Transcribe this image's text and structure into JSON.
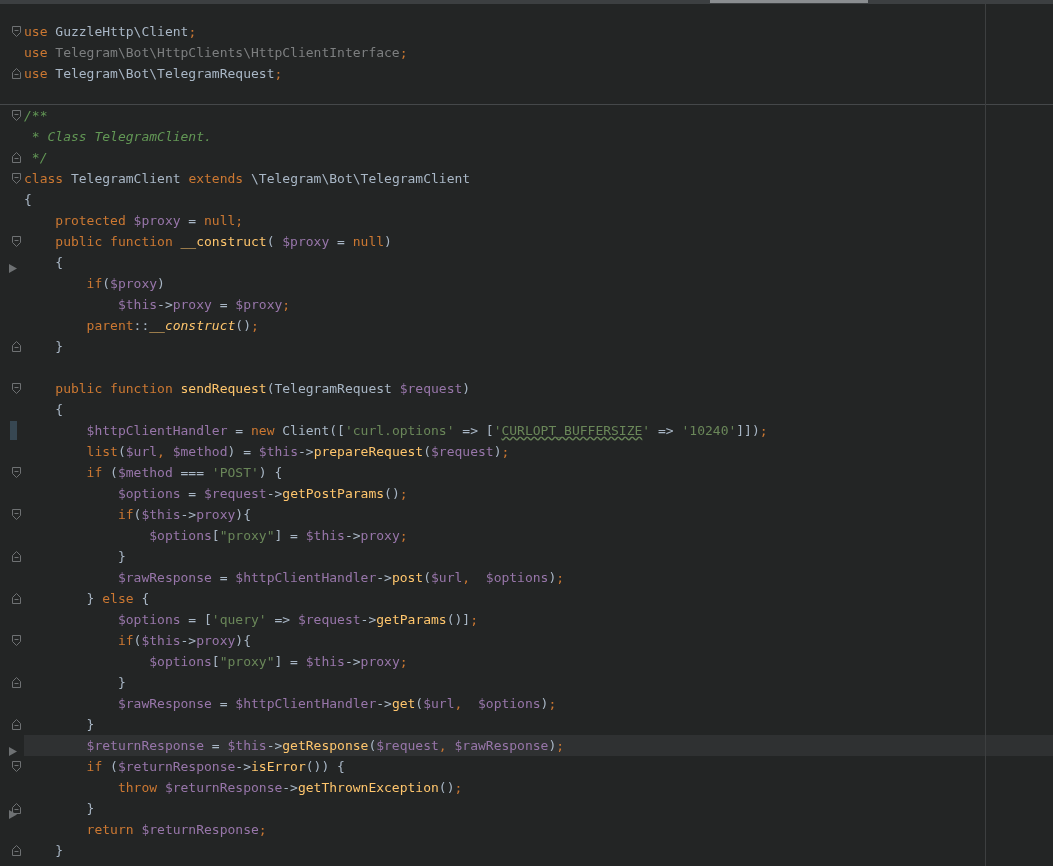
{
  "editor": {
    "lines": [
      {
        "fold_start": true,
        "fold_end": false,
        "selected": false,
        "tokens": [
          {
            "kind": "kw",
            "text": "use "
          },
          {
            "kind": "plain",
            "text": "GuzzleHttp\\Client"
          },
          {
            "kind": "kw",
            "text": ";"
          }
        ]
      },
      {
        "fold_start": false,
        "fold_end": false,
        "selected": false,
        "tokens": [
          {
            "kind": "kw",
            "text": "use "
          },
          {
            "kind": "dim",
            "text": "Telegram\\Bot\\HttpClients\\HttpClientInterface"
          },
          {
            "kind": "kw",
            "text": ";"
          }
        ]
      },
      {
        "fold_start": false,
        "fold_end": true,
        "selected": false,
        "tokens": [
          {
            "kind": "kw",
            "text": "use "
          },
          {
            "kind": "plain",
            "text": "Telegram\\Bot\\TelegramRequest"
          },
          {
            "kind": "kw",
            "text": ";"
          }
        ]
      },
      {
        "fold_start": true,
        "fold_end": false,
        "selected": false,
        "section_break": true,
        "tokens": [
          {
            "kind": "doc",
            "text": "/**"
          }
        ]
      },
      {
        "fold_start": false,
        "fold_end": false,
        "selected": false,
        "tokens": [
          {
            "kind": "doc",
            "text": " * Class TelegramClient."
          }
        ]
      },
      {
        "fold_start": false,
        "fold_end": true,
        "selected": false,
        "tokens": [
          {
            "kind": "doc",
            "text": " */"
          }
        ]
      },
      {
        "fold_start": true,
        "fold_end": false,
        "selected": false,
        "tokens": [
          {
            "kind": "kw",
            "text": "class "
          },
          {
            "kind": "plain",
            "text": "TelegramClient "
          },
          {
            "kind": "kw",
            "text": "extends "
          },
          {
            "kind": "plain",
            "text": "\\Telegram\\Bot\\TelegramClient"
          }
        ]
      },
      {
        "fold_start": false,
        "fold_end": false,
        "selected": false,
        "tokens": [
          {
            "kind": "plain",
            "text": "{"
          }
        ]
      },
      {
        "fold_start": false,
        "fold_end": false,
        "selected": false,
        "tokens": [
          {
            "kind": "kw",
            "text": "    protected "
          },
          {
            "kind": "var",
            "text": "$proxy"
          },
          {
            "kind": "plain",
            "text": " = "
          },
          {
            "kind": "kw",
            "text": "null;"
          }
        ]
      },
      {
        "fold_start": true,
        "fold_end": false,
        "selected": false,
        "tokens": [
          {
            "kind": "kw",
            "text": "    public function "
          },
          {
            "kind": "fn",
            "text": "__construct"
          },
          {
            "kind": "plain",
            "text": "( "
          },
          {
            "kind": "var",
            "text": "$proxy"
          },
          {
            "kind": "plain",
            "text": " = "
          },
          {
            "kind": "kw",
            "text": "null"
          },
          {
            "kind": "plain",
            "text": ")"
          }
        ]
      },
      {
        "fold_start": false,
        "fold_end": false,
        "selected": false,
        "arrow": true,
        "tokens": [
          {
            "kind": "plain",
            "text": "    {"
          }
        ]
      },
      {
        "fold_start": false,
        "fold_end": false,
        "selected": false,
        "tokens": [
          {
            "kind": "kw",
            "text": "        if"
          },
          {
            "kind": "plain",
            "text": "("
          },
          {
            "kind": "var",
            "text": "$proxy"
          },
          {
            "kind": "plain",
            "text": ")"
          }
        ]
      },
      {
        "fold_start": false,
        "fold_end": false,
        "selected": false,
        "tokens": [
          {
            "kind": "var",
            "text": "            $this"
          },
          {
            "kind": "plain",
            "text": "->"
          },
          {
            "kind": "var",
            "text": "proxy"
          },
          {
            "kind": "plain",
            "text": " = "
          },
          {
            "kind": "var",
            "text": "$proxy"
          },
          {
            "kind": "kw",
            "text": ";"
          }
        ]
      },
      {
        "fold_start": false,
        "fold_end": false,
        "selected": false,
        "tokens": [
          {
            "kind": "kw",
            "text": "        parent"
          },
          {
            "kind": "plain",
            "text": "::"
          },
          {
            "kind": "fnit",
            "text": "__construct"
          },
          {
            "kind": "plain",
            "text": "()"
          },
          {
            "kind": "kw",
            "text": ";"
          }
        ]
      },
      {
        "fold_start": false,
        "fold_end": true,
        "selected": false,
        "tokens": [
          {
            "kind": "plain",
            "text": "    }"
          }
        ]
      },
      {
        "fold_start": true,
        "fold_end": false,
        "selected": false,
        "space_before": true,
        "tokens": [
          {
            "kind": "kw",
            "text": "    public function "
          },
          {
            "kind": "fn",
            "text": "sendRequest"
          },
          {
            "kind": "plain",
            "text": "(TelegramRequest "
          },
          {
            "kind": "var",
            "text": "$request"
          },
          {
            "kind": "plain",
            "text": ")"
          }
        ]
      },
      {
        "fold_start": false,
        "fold_end": false,
        "selected": false,
        "tokens": [
          {
            "kind": "plain",
            "text": "    {"
          }
        ]
      },
      {
        "fold_start": false,
        "fold_end": false,
        "selected": false,
        "changed": true,
        "tokens": [
          {
            "kind": "var",
            "text": "        $httpClientHandler"
          },
          {
            "kind": "plain",
            "text": " = "
          },
          {
            "kind": "kw",
            "text": "new "
          },
          {
            "kind": "plain",
            "text": "Client(["
          },
          {
            "kind": "str",
            "text": "'curl.options'"
          },
          {
            "kind": "plain",
            "text": " => ["
          },
          {
            "kind": "str",
            "text": "'"
          },
          {
            "kind": "strw",
            "text": "CURLOPT_BUFFERSIZE"
          },
          {
            "kind": "str",
            "text": "'"
          },
          {
            "kind": "plain",
            "text": " => "
          },
          {
            "kind": "str",
            "text": "'10240'"
          },
          {
            "kind": "plain",
            "text": "]])"
          },
          {
            "kind": "kw",
            "text": ";"
          }
        ]
      },
      {
        "fold_start": false,
        "fold_end": false,
        "selected": false,
        "tokens": [
          {
            "kind": "kw",
            "text": "        list"
          },
          {
            "kind": "plain",
            "text": "("
          },
          {
            "kind": "var",
            "text": "$url"
          },
          {
            "kind": "kw",
            "text": ", "
          },
          {
            "kind": "var",
            "text": "$method"
          },
          {
            "kind": "plain",
            "text": ") = "
          },
          {
            "kind": "var",
            "text": "$this"
          },
          {
            "kind": "plain",
            "text": "->"
          },
          {
            "kind": "fn",
            "text": "prepareRequest"
          },
          {
            "kind": "plain",
            "text": "("
          },
          {
            "kind": "var",
            "text": "$request"
          },
          {
            "kind": "plain",
            "text": ")"
          },
          {
            "kind": "kw",
            "text": ";"
          }
        ]
      },
      {
        "fold_start": true,
        "fold_end": false,
        "selected": false,
        "tokens": [
          {
            "kind": "kw",
            "text": "        if "
          },
          {
            "kind": "plain",
            "text": "("
          },
          {
            "kind": "var",
            "text": "$method"
          },
          {
            "kind": "plain",
            "text": " === "
          },
          {
            "kind": "str",
            "text": "'POST'"
          },
          {
            "kind": "plain",
            "text": ") {"
          }
        ]
      },
      {
        "fold_start": false,
        "fold_end": false,
        "selected": false,
        "tokens": [
          {
            "kind": "var",
            "text": "            $options"
          },
          {
            "kind": "plain",
            "text": " = "
          },
          {
            "kind": "var",
            "text": "$request"
          },
          {
            "kind": "plain",
            "text": "->"
          },
          {
            "kind": "fn",
            "text": "getPostParams"
          },
          {
            "kind": "plain",
            "text": "()"
          },
          {
            "kind": "kw",
            "text": ";"
          }
        ]
      },
      {
        "fold_start": true,
        "fold_end": false,
        "selected": false,
        "tokens": [
          {
            "kind": "kw",
            "text": "            if"
          },
          {
            "kind": "plain",
            "text": "("
          },
          {
            "kind": "var",
            "text": "$this"
          },
          {
            "kind": "plain",
            "text": "->"
          },
          {
            "kind": "var",
            "text": "proxy"
          },
          {
            "kind": "plain",
            "text": "){"
          }
        ]
      },
      {
        "fold_start": false,
        "fold_end": false,
        "selected": false,
        "tokens": [
          {
            "kind": "var",
            "text": "                $options"
          },
          {
            "kind": "plain",
            "text": "["
          },
          {
            "kind": "str",
            "text": "\"proxy\""
          },
          {
            "kind": "plain",
            "text": "] = "
          },
          {
            "kind": "var",
            "text": "$this"
          },
          {
            "kind": "plain",
            "text": "->"
          },
          {
            "kind": "var",
            "text": "proxy"
          },
          {
            "kind": "kw",
            "text": ";"
          }
        ]
      },
      {
        "fold_start": false,
        "fold_end": true,
        "selected": false,
        "tokens": [
          {
            "kind": "plain",
            "text": "            }"
          }
        ]
      },
      {
        "fold_start": false,
        "fold_end": false,
        "selected": false,
        "tokens": [
          {
            "kind": "var",
            "text": "            $rawResponse"
          },
          {
            "kind": "plain",
            "text": " = "
          },
          {
            "kind": "var",
            "text": "$httpClientHandler"
          },
          {
            "kind": "plain",
            "text": "->"
          },
          {
            "kind": "fn",
            "text": "post"
          },
          {
            "kind": "plain",
            "text": "("
          },
          {
            "kind": "var",
            "text": "$url"
          },
          {
            "kind": "kw",
            "text": ",  "
          },
          {
            "kind": "var",
            "text": "$options"
          },
          {
            "kind": "plain",
            "text": ")"
          },
          {
            "kind": "kw",
            "text": ";"
          }
        ]
      },
      {
        "fold_start": false,
        "fold_end": true,
        "selected": false,
        "tokens": [
          {
            "kind": "plain",
            "text": "        } "
          },
          {
            "kind": "kw",
            "text": "else "
          },
          {
            "kind": "plain",
            "text": "{"
          }
        ]
      },
      {
        "fold_start": false,
        "fold_end": false,
        "selected": false,
        "tokens": [
          {
            "kind": "var",
            "text": "            $options"
          },
          {
            "kind": "plain",
            "text": " = ["
          },
          {
            "kind": "str",
            "text": "'query'"
          },
          {
            "kind": "plain",
            "text": " => "
          },
          {
            "kind": "var",
            "text": "$request"
          },
          {
            "kind": "plain",
            "text": "->"
          },
          {
            "kind": "fn",
            "text": "getParams"
          },
          {
            "kind": "plain",
            "text": "()]"
          },
          {
            "kind": "kw",
            "text": ";"
          }
        ]
      },
      {
        "fold_start": true,
        "fold_end": false,
        "selected": false,
        "tokens": [
          {
            "kind": "kw",
            "text": "            if"
          },
          {
            "kind": "plain",
            "text": "("
          },
          {
            "kind": "var",
            "text": "$this"
          },
          {
            "kind": "plain",
            "text": "->"
          },
          {
            "kind": "var",
            "text": "proxy"
          },
          {
            "kind": "plain",
            "text": "){"
          }
        ]
      },
      {
        "fold_start": false,
        "fold_end": false,
        "selected": false,
        "tokens": [
          {
            "kind": "var",
            "text": "                $options"
          },
          {
            "kind": "plain",
            "text": "["
          },
          {
            "kind": "str",
            "text": "\"proxy\""
          },
          {
            "kind": "plain",
            "text": "] = "
          },
          {
            "kind": "var",
            "text": "$this"
          },
          {
            "kind": "plain",
            "text": "->"
          },
          {
            "kind": "var",
            "text": "proxy"
          },
          {
            "kind": "kw",
            "text": ";"
          }
        ]
      },
      {
        "fold_start": false,
        "fold_end": true,
        "selected": false,
        "tokens": [
          {
            "kind": "plain",
            "text": "            }"
          }
        ]
      },
      {
        "fold_start": false,
        "fold_end": false,
        "selected": false,
        "tokens": [
          {
            "kind": "var",
            "text": "            $rawResponse"
          },
          {
            "kind": "plain",
            "text": " = "
          },
          {
            "kind": "var",
            "text": "$httpClientHandler"
          },
          {
            "kind": "plain",
            "text": "->"
          },
          {
            "kind": "fn",
            "text": "get"
          },
          {
            "kind": "plain",
            "text": "("
          },
          {
            "kind": "var",
            "text": "$url"
          },
          {
            "kind": "kw",
            "text": ",  "
          },
          {
            "kind": "var",
            "text": "$options"
          },
          {
            "kind": "plain",
            "text": ")"
          },
          {
            "kind": "kw",
            "text": ";"
          }
        ]
      },
      {
        "fold_start": false,
        "fold_end": true,
        "selected": false,
        "tokens": [
          {
            "kind": "plain",
            "text": "        }"
          }
        ]
      },
      {
        "fold_start": false,
        "fold_end": false,
        "selected": true,
        "arrow": true,
        "tokens": [
          {
            "kind": "var",
            "text": "        $returnResponse"
          },
          {
            "kind": "plain",
            "text": " = "
          },
          {
            "kind": "var",
            "text": "$this"
          },
          {
            "kind": "plain",
            "text": "->"
          },
          {
            "kind": "fn",
            "text": "getResponse"
          },
          {
            "kind": "plain",
            "text": "("
          },
          {
            "kind": "var",
            "text": "$request"
          },
          {
            "kind": "kw",
            "text": ", "
          },
          {
            "kind": "var",
            "text": "$rawResponse"
          },
          {
            "kind": "plain",
            "text": ")"
          },
          {
            "kind": "kw",
            "text": ";"
          }
        ]
      },
      {
        "fold_start": true,
        "fold_end": false,
        "selected": false,
        "tokens": [
          {
            "kind": "kw",
            "text": "        if "
          },
          {
            "kind": "plain",
            "text": "("
          },
          {
            "kind": "var",
            "text": "$returnResponse"
          },
          {
            "kind": "plain",
            "text": "->"
          },
          {
            "kind": "fn",
            "text": "isError"
          },
          {
            "kind": "plain",
            "text": "()) {"
          }
        ]
      },
      {
        "fold_start": false,
        "fold_end": false,
        "selected": false,
        "tokens": [
          {
            "kind": "kw",
            "text": "            throw "
          },
          {
            "kind": "var",
            "text": "$returnResponse"
          },
          {
            "kind": "plain",
            "text": "->"
          },
          {
            "kind": "fn",
            "text": "getThrownException"
          },
          {
            "kind": "plain",
            "text": "()"
          },
          {
            "kind": "kw",
            "text": ";"
          }
        ]
      },
      {
        "fold_start": false,
        "fold_end": true,
        "selected": false,
        "arrow": true,
        "tokens": [
          {
            "kind": "plain",
            "text": "        }"
          }
        ]
      },
      {
        "fold_start": false,
        "fold_end": false,
        "selected": false,
        "tokens": [
          {
            "kind": "kw",
            "text": "        return "
          },
          {
            "kind": "var",
            "text": "$returnResponse"
          },
          {
            "kind": "kw",
            "text": ";"
          }
        ]
      },
      {
        "fold_start": false,
        "fold_end": true,
        "selected": false,
        "tokens": [
          {
            "kind": "plain",
            "text": "    }"
          }
        ]
      }
    ]
  }
}
